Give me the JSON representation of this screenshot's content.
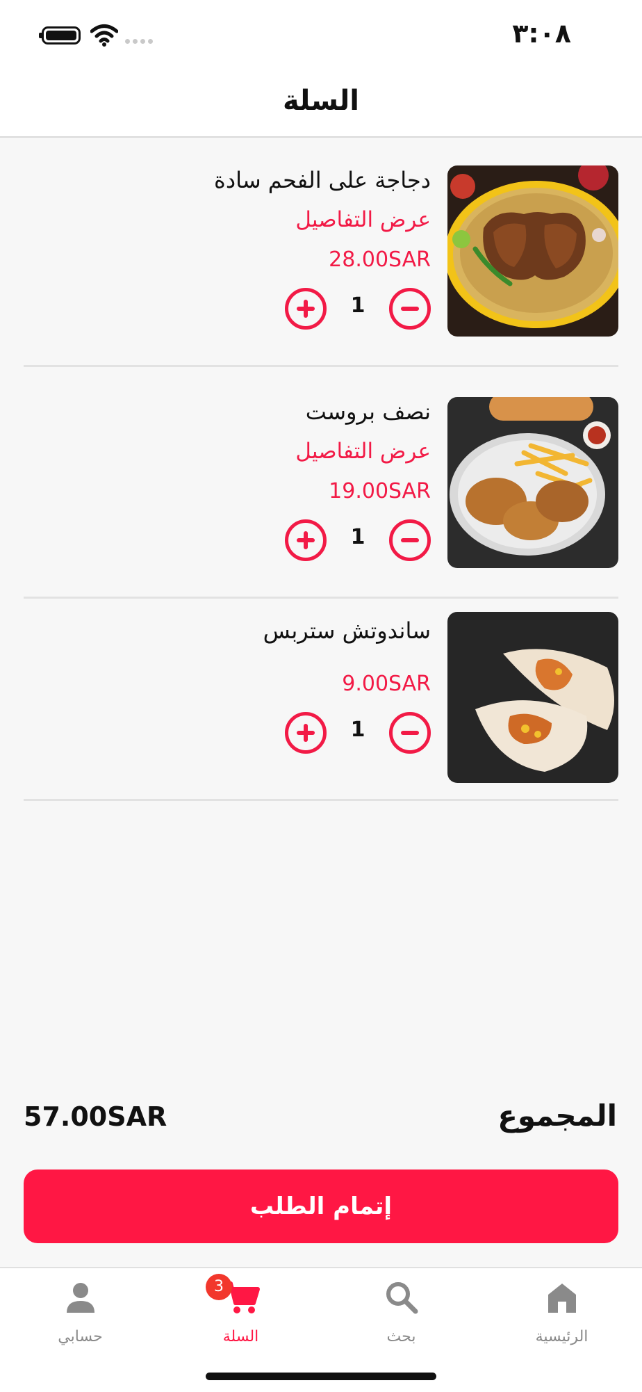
{
  "status_bar": {
    "time": "٣:٠٨"
  },
  "header": {
    "title": "السلة"
  },
  "cart": {
    "items": [
      {
        "name": "دجاجة على الفحم سادة",
        "details_label": "عرض التفاصيل",
        "price": "28.00SAR",
        "quantity": "1"
      },
      {
        "name": "نصف بروست",
        "details_label": "عرض التفاصيل",
        "price": "19.00SAR",
        "quantity": "1"
      },
      {
        "name": "ساندوتش ستربس",
        "price": "9.00SAR",
        "quantity": "1"
      }
    ]
  },
  "summary": {
    "total_label": "المجموع",
    "total_value": "57.00SAR"
  },
  "checkout": {
    "label": "إتمام الطلب"
  },
  "tabbar": {
    "tabs": [
      {
        "label": "حسابي",
        "icon": "person-icon"
      },
      {
        "label": "السلة",
        "icon": "cart-icon",
        "badge": "3",
        "active": true
      },
      {
        "label": "بحث",
        "icon": "search-icon"
      },
      {
        "label": "الرئيسية",
        "icon": "home-icon"
      }
    ]
  },
  "colors": {
    "accent": "#ff1744",
    "price_text": "#f21a46",
    "inactive_tab": "#8a8a8a"
  }
}
